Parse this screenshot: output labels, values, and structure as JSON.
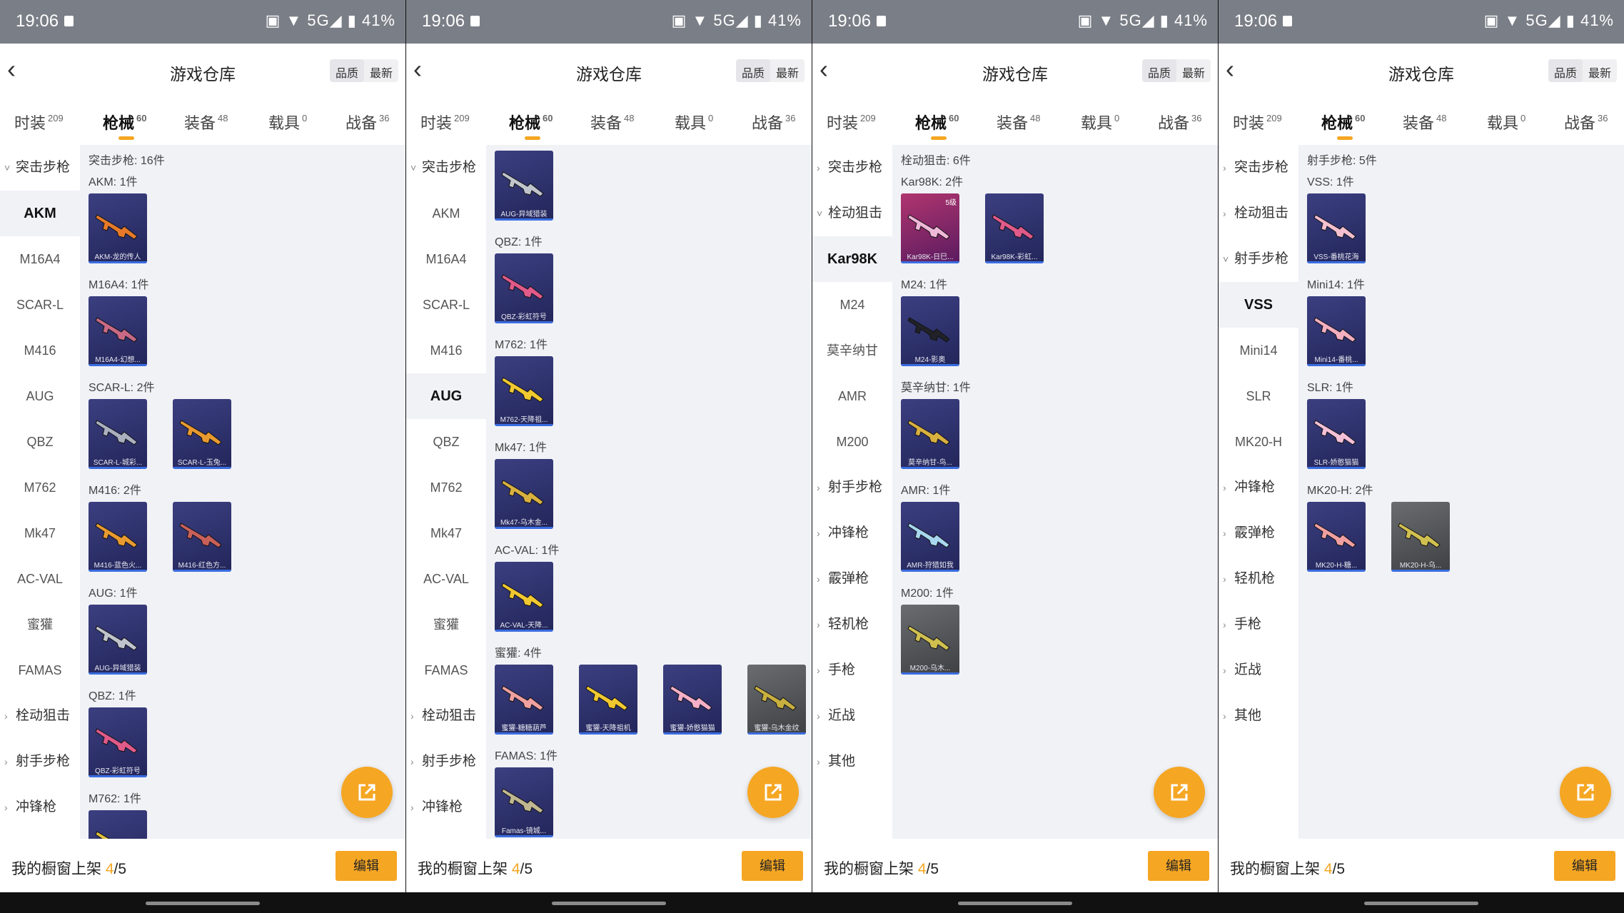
{
  "status": {
    "time": "19:06",
    "battery": "41%",
    "signal": "▣ ▼ 5G◢ ▮"
  },
  "header": {
    "title": "游戏仓库",
    "sort_quality": "品质",
    "sort_newest": "最新"
  },
  "tabs": [
    {
      "label": "时装",
      "count": "209"
    },
    {
      "label": "枪械",
      "count": "60"
    },
    {
      "label": "装备",
      "count": "48"
    },
    {
      "label": "载具",
      "count": "0"
    },
    {
      "label": "战备",
      "count": "36"
    }
  ],
  "bottom": {
    "prefix": "我的橱窗上架 ",
    "current": "4",
    "total": "/5",
    "edit": "编辑"
  },
  "colors": {
    "accent": "#f5a623",
    "card": "#2f3270",
    "card_gold": "#b0356f"
  },
  "icons": {
    "back": "chevron-left-icon",
    "share": "share-external-icon",
    "chevron": "chevron-icon"
  },
  "panels": [
    {
      "sidebar": [
        {
          "label": "突击步枪",
          "cat": true,
          "expanded": true
        },
        {
          "label": "AKM",
          "selected": true
        },
        {
          "label": "M16A4"
        },
        {
          "label": "SCAR-L"
        },
        {
          "label": "M416"
        },
        {
          "label": "AUG"
        },
        {
          "label": "QBZ"
        },
        {
          "label": "M762"
        },
        {
          "label": "Mk47"
        },
        {
          "label": "AC-VAL"
        },
        {
          "label": "蜜獾"
        },
        {
          "label": "FAMAS"
        },
        {
          "label": "栓动狙击",
          "cat": true
        },
        {
          "label": "射手步枪",
          "cat": true
        },
        {
          "label": "冲锋枪",
          "cat": true
        }
      ],
      "content": [
        {
          "type": "label",
          "text": "突击步枪: 16件"
        },
        {
          "type": "label",
          "text": "AKM: 1件"
        },
        {
          "type": "cards",
          "items": [
            {
              "caption": "AKM-龙的传人",
              "color": "#e67a2a"
            }
          ]
        },
        {
          "type": "label",
          "text": "M16A4: 1件"
        },
        {
          "type": "cards",
          "items": [
            {
              "caption": "M16A4-幻想...",
              "color": "#c86a86"
            }
          ]
        },
        {
          "type": "label",
          "text": "SCAR-L: 2件"
        },
        {
          "type": "cards",
          "items": [
            {
              "caption": "SCAR-L-城彩...",
              "color": "#aab0c0"
            },
            {
              "caption": "SCAR-L-玉兔...",
              "color": "#e89a30"
            }
          ]
        },
        {
          "type": "label",
          "text": "M416: 2件"
        },
        {
          "type": "cards",
          "items": [
            {
              "caption": "M416-蓝色火...",
              "color": "#e89a30"
            },
            {
              "caption": "M416-红色方...",
              "color": "#c8605a"
            }
          ]
        },
        {
          "type": "label",
          "text": "AUG: 1件"
        },
        {
          "type": "cards",
          "items": [
            {
              "caption": "AUG-异域猎装",
              "color": "#c0c4cc"
            }
          ]
        },
        {
          "type": "label",
          "text": "QBZ: 1件"
        },
        {
          "type": "cards",
          "items": [
            {
              "caption": "QBZ-彩虹符号",
              "color": "#e05a8a"
            }
          ]
        },
        {
          "type": "label",
          "text": "M762: 1件"
        },
        {
          "type": "cards",
          "items": [
            {
              "caption": "",
              "color": "#e0c040"
            }
          ]
        }
      ]
    },
    {
      "sidebar": [
        {
          "label": "突击步枪",
          "cat": true,
          "expanded": true
        },
        {
          "label": "AKM"
        },
        {
          "label": "M16A4"
        },
        {
          "label": "SCAR-L"
        },
        {
          "label": "M416"
        },
        {
          "label": "AUG",
          "selected": true
        },
        {
          "label": "QBZ"
        },
        {
          "label": "M762"
        },
        {
          "label": "Mk47"
        },
        {
          "label": "AC-VAL"
        },
        {
          "label": "蜜獾"
        },
        {
          "label": "FAMAS"
        },
        {
          "label": "栓动狙击",
          "cat": true
        },
        {
          "label": "射手步枪",
          "cat": true
        },
        {
          "label": "冲锋枪",
          "cat": true
        }
      ],
      "content": [
        {
          "type": "cards",
          "items": [
            {
              "caption": "AUG-异域猎装",
              "color": "#c0c4cc"
            }
          ]
        },
        {
          "type": "label",
          "text": "QBZ: 1件"
        },
        {
          "type": "cards",
          "items": [
            {
              "caption": "QBZ-彩虹符号",
              "color": "#e05a8a"
            }
          ]
        },
        {
          "type": "label",
          "text": "M762: 1件"
        },
        {
          "type": "cards",
          "items": [
            {
              "caption": "M762-天降祖...",
              "color": "#f0c830"
            }
          ]
        },
        {
          "type": "label",
          "text": "Mk47: 1件"
        },
        {
          "type": "cards",
          "items": [
            {
              "caption": "Mk47-乌木金...",
              "color": "#d8b040"
            }
          ]
        },
        {
          "type": "label",
          "text": "AC-VAL: 1件"
        },
        {
          "type": "cards",
          "items": [
            {
              "caption": "AC-VAL-天降...",
              "color": "#f0c830"
            }
          ]
        },
        {
          "type": "label",
          "text": "蜜獾: 4件"
        },
        {
          "type": "cards",
          "items": [
            {
              "caption": "蜜獾-糖糖葫芦",
              "color": "#f0a0a0"
            },
            {
              "caption": "蜜獾-天降祖机",
              "color": "#f0c830"
            },
            {
              "caption": "蜜獾-娇憨猫猫",
              "color": "#f4b0c8"
            },
            {
              "caption": "蜜獾-乌木金纹",
              "color": "#c8b040",
              "gray": true
            }
          ]
        },
        {
          "type": "label",
          "text": "FAMAS: 1件"
        },
        {
          "type": "cards",
          "items": [
            {
              "caption": "Famas-镜城...",
              "color": "#c0b890"
            }
          ]
        }
      ]
    },
    {
      "sidebar": [
        {
          "label": "突击步枪",
          "cat": true
        },
        {
          "label": "栓动狙击",
          "cat": true,
          "expanded": true
        },
        {
          "label": "Kar98K",
          "selected": true
        },
        {
          "label": "M24"
        },
        {
          "label": "莫辛纳甘"
        },
        {
          "label": "AMR"
        },
        {
          "label": "M200"
        },
        {
          "label": "射手步枪",
          "cat": true
        },
        {
          "label": "冲锋枪",
          "cat": true
        },
        {
          "label": "霰弹枪",
          "cat": true
        },
        {
          "label": "轻机枪",
          "cat": true
        },
        {
          "label": "手枪",
          "cat": true
        },
        {
          "label": "近战",
          "cat": true
        },
        {
          "label": "其他",
          "cat": true
        }
      ],
      "content": [
        {
          "type": "label",
          "text": "栓动狙击: 6件"
        },
        {
          "type": "label",
          "text": "Kar98K: 2件"
        },
        {
          "type": "cards",
          "items": [
            {
              "caption": "Kar98K-日巳...",
              "color": "#f0b8d8",
              "pink": true,
              "tag": "5级"
            },
            {
              "caption": "Kar98K-彩虹...",
              "color": "#e05a8a"
            }
          ]
        },
        {
          "type": "label",
          "text": "M24: 1件"
        },
        {
          "type": "cards",
          "items": [
            {
              "caption": "M24-影奥",
              "color": "#202228"
            }
          ]
        },
        {
          "type": "label",
          "text": "莫辛纳甘: 1件"
        },
        {
          "type": "cards",
          "items": [
            {
              "caption": "莫辛纳甘-鸟...",
              "color": "#d8b040"
            }
          ]
        },
        {
          "type": "label",
          "text": "AMR: 1件"
        },
        {
          "type": "cards",
          "items": [
            {
              "caption": "AMR-狩猎如我",
              "color": "#a8d8f0"
            }
          ]
        },
        {
          "type": "label",
          "text": "M200: 1件"
        },
        {
          "type": "cards",
          "items": [
            {
              "caption": "M200-乌木...",
              "color": "#d0c050",
              "gray": true
            }
          ]
        }
      ]
    },
    {
      "sidebar": [
        {
          "label": "突击步枪",
          "cat": true
        },
        {
          "label": "栓动狙击",
          "cat": true
        },
        {
          "label": "射手步枪",
          "cat": true,
          "expanded": true
        },
        {
          "label": "VSS",
          "selected": true
        },
        {
          "label": "Mini14"
        },
        {
          "label": "SLR"
        },
        {
          "label": "MK20-H"
        },
        {
          "label": "冲锋枪",
          "cat": true
        },
        {
          "label": "霰弹枪",
          "cat": true
        },
        {
          "label": "轻机枪",
          "cat": true
        },
        {
          "label": "手枪",
          "cat": true
        },
        {
          "label": "近战",
          "cat": true
        },
        {
          "label": "其他",
          "cat": true
        }
      ],
      "content": [
        {
          "type": "label",
          "text": "射手步枪: 5件"
        },
        {
          "type": "label",
          "text": "VSS: 1件"
        },
        {
          "type": "cards",
          "items": [
            {
              "caption": "VSS-番桃花海",
              "color": "#f4c0d0"
            }
          ]
        },
        {
          "type": "label",
          "text": "Mini14: 1件"
        },
        {
          "type": "cards",
          "items": [
            {
              "caption": "Mini14-番桃...",
              "color": "#f4b0c0"
            }
          ]
        },
        {
          "type": "label",
          "text": "SLR: 1件"
        },
        {
          "type": "cards",
          "items": [
            {
              "caption": "SLR-娇憨猫猫",
              "color": "#f4c0d8"
            }
          ]
        },
        {
          "type": "label",
          "text": "MK20-H: 2件"
        },
        {
          "type": "cards",
          "items": [
            {
              "caption": "MK20-H-糖...",
              "color": "#f0a0a0"
            },
            {
              "caption": "MK20-H-乌...",
              "color": "#d0c050",
              "gray": true
            }
          ]
        }
      ]
    }
  ]
}
